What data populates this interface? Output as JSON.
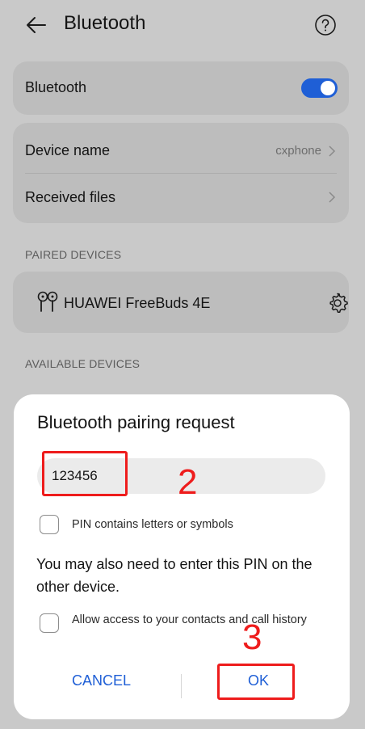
{
  "header": {
    "title": "Bluetooth",
    "back_icon": "back-arrow-icon",
    "help_icon": "help-icon"
  },
  "bluetooth_card": {
    "label": "Bluetooth",
    "toggle_on": true,
    "accent": "#1f5fd6"
  },
  "device_card": {
    "device_name_label": "Device name",
    "device_name_value": "cxphone",
    "received_files_label": "Received files"
  },
  "paired": {
    "section_title": "PAIRED DEVICES",
    "device_name": "HUAWEI FreeBuds 4E"
  },
  "available": {
    "section_title": "AVAILABLE DEVICES"
  },
  "dialog": {
    "title": "Bluetooth pairing request",
    "pin_value": "123456",
    "pin_letters_label": "PIN contains letters or symbols",
    "message": "You may also need to enter this PIN on the other device.",
    "contacts_label": "Allow access to your contacts and call history",
    "cancel_label": "CANCEL",
    "ok_label": "OK"
  },
  "annotations": {
    "step_pin": "2",
    "step_ok": "3",
    "color": "#ee1c1c"
  }
}
